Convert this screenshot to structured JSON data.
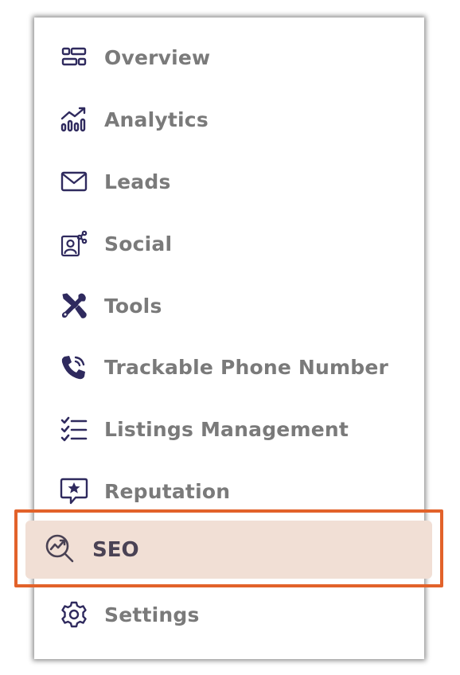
{
  "menu": {
    "items": [
      {
        "label": "Overview",
        "icon": "dashboard-icon"
      },
      {
        "label": "Analytics",
        "icon": "analytics-chart-icon"
      },
      {
        "label": "Leads",
        "icon": "envelope-icon"
      },
      {
        "label": "Social",
        "icon": "social-profile-icon"
      },
      {
        "label": "Tools",
        "icon": "tools-icon"
      },
      {
        "label": "Trackable Phone Number",
        "icon": "phone-ringing-icon"
      },
      {
        "label": "Listings Management",
        "icon": "checklist-icon"
      },
      {
        "label": "Reputation",
        "icon": "star-speech-bubble-icon"
      },
      {
        "label": "SEO",
        "icon": "seo-search-icon",
        "active": true
      },
      {
        "label": "Settings",
        "icon": "gear-icon"
      }
    ]
  },
  "colors": {
    "icon": "#2f2a5e",
    "label": "#7a7a7a",
    "active_bg": "#f1dfd5",
    "active_label": "#4a4254",
    "highlight_border": "#e2622a"
  }
}
